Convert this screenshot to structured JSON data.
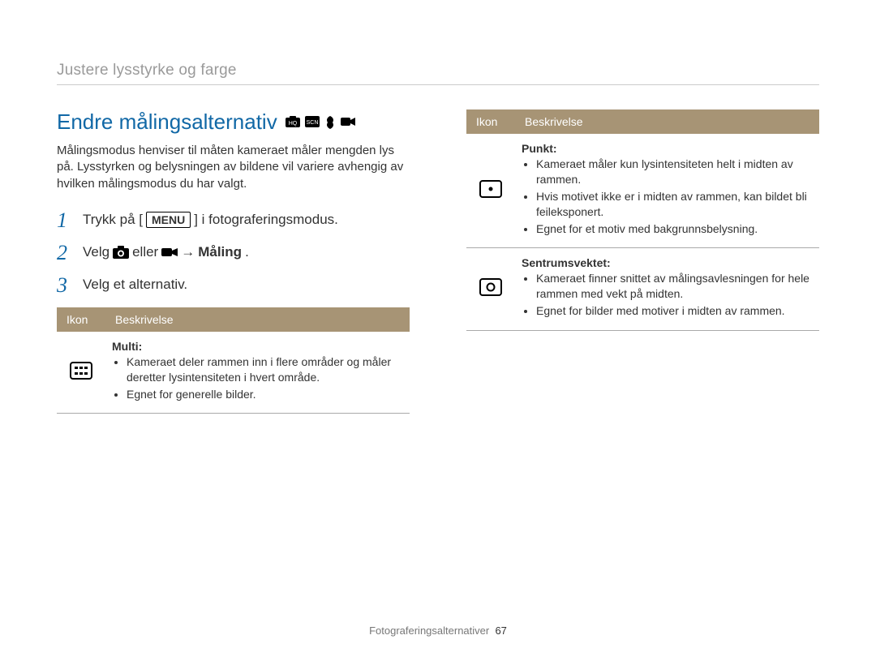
{
  "breadcrumb": "Justere lysstyrke og farge",
  "heading": "Endre målingsalternativ",
  "mode_icons": [
    "hq-icon",
    "scn-icon",
    "dual-is-icon",
    "video-icon"
  ],
  "intro": "Målingsmodus henviser til måten kameraet måler mengden lys på. Lysstyrken og belysningen av bildene vil variere avhengig av hvilken målingsmodus du har valgt.",
  "steps": {
    "s1_pre": "Trykk på [",
    "s1_menu": "MENU",
    "s1_post": "] i fotograferingsmodus.",
    "s2_pre": "Velg",
    "s2_mid": "eller",
    "s2_arrow": "→",
    "s2_bold": "Måling",
    "s3": "Velg et alternativ."
  },
  "table": {
    "th_icon": "Ikon",
    "th_desc": "Beskrivelse",
    "rows_left": [
      {
        "icon": "metering-multi",
        "title": "Multi:",
        "items": [
          "Kameraet deler rammen inn i flere områder og måler deretter lysintensiteten i hvert område.",
          "Egnet for generelle bilder."
        ]
      }
    ],
    "rows_right": [
      {
        "icon": "metering-spot",
        "title": "Punkt:",
        "items": [
          "Kameraet måler kun lysintensiteten helt i midten av rammen.",
          "Hvis motivet ikke er i midten av rammen, kan bildet bli feileksponert.",
          "Egnet for et motiv med bakgrunnsbelysning."
        ]
      },
      {
        "icon": "metering-center",
        "title": "Sentrumsvektet:",
        "items": [
          "Kameraet finner snittet av målingsavlesningen for hele rammen med vekt på midten.",
          "Egnet for bilder med motiver i midten av rammen."
        ]
      }
    ]
  },
  "footer_label": "Fotograferingsalternativer",
  "footer_page": "67"
}
